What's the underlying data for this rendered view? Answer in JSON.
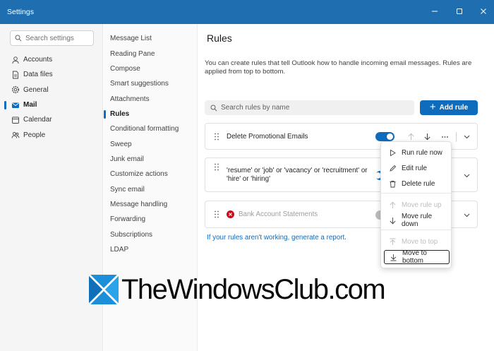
{
  "window": {
    "title": "Settings",
    "controls": [
      "minimize-icon",
      "maximize-icon",
      "close-icon"
    ]
  },
  "sidebar": {
    "search_placeholder": "Search settings",
    "items": [
      {
        "label": "Accounts",
        "icon": "person-icon"
      },
      {
        "label": "Data files",
        "icon": "document-icon"
      },
      {
        "label": "General",
        "icon": "gear-icon"
      },
      {
        "label": "Mail",
        "icon": "mail-icon",
        "active": true
      },
      {
        "label": "Calendar",
        "icon": "calendar-icon"
      },
      {
        "label": "People",
        "icon": "people-icon"
      }
    ]
  },
  "subnav": {
    "items": [
      "Message List",
      "Reading Pane",
      "Compose",
      "Smart suggestions",
      "Attachments",
      "Rules",
      "Conditional formatting",
      "Sweep",
      "Junk email",
      "Customize actions",
      "Sync email",
      "Message handling",
      "Forwarding",
      "Subscriptions",
      "LDAP"
    ],
    "active": "Rules"
  },
  "main": {
    "title": "Rules",
    "description": "You can create rules that tell Outlook how to handle incoming email messages. Rules are applied from top to bottom.",
    "search_placeholder": "Search rules by name",
    "add_rule_label": "Add rule",
    "rules": [
      {
        "name": "Delete Promotional Emails",
        "enabled": true
      },
      {
        "name": "'resume' or 'job' or 'vacancy' or 'recruitment' or 'hire' or 'hiring'",
        "enabled": true
      },
      {
        "name": "Bank Account Statements",
        "enabled": false,
        "error": true
      }
    ],
    "help_link": "If your rules aren't working, generate a report."
  },
  "context_menu": {
    "items": [
      {
        "label": "Run rule now",
        "icon": "play-icon",
        "disabled": false
      },
      {
        "label": "Edit rule",
        "icon": "pencil-icon",
        "disabled": false
      },
      {
        "label": "Delete rule",
        "icon": "trash-icon",
        "disabled": false
      },
      {
        "label": "Move rule up",
        "icon": "arrow-up-icon",
        "disabled": true
      },
      {
        "label": "Move rule down",
        "icon": "arrow-down-icon",
        "disabled": false
      },
      {
        "label": "Move to top",
        "icon": "arrow-to-top-icon",
        "disabled": true
      },
      {
        "label": "Move to bottom",
        "icon": "arrow-to-bottom-icon",
        "disabled": false,
        "focused": true
      }
    ]
  },
  "watermark": {
    "text": "TheWindowsClub.com"
  },
  "colors": {
    "titlebar": "#1f6fb0",
    "accent": "#0f6cbd",
    "error": "#c50f1f"
  }
}
